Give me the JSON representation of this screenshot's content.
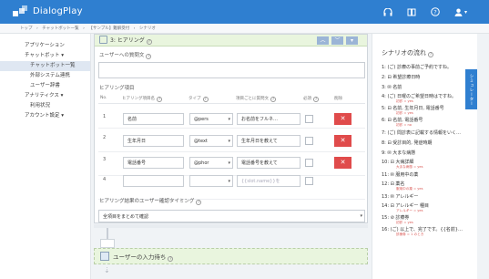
{
  "app": {
    "name": "DialogPlay"
  },
  "header": {
    "icons": [
      "headset-icon",
      "book-icon",
      "help-icon",
      "user-icon"
    ],
    "user_caret": "▾"
  },
  "breadcrumb": [
    "トップ",
    "›",
    "チャットボット一覧",
    "›",
    "【サンプル】難解受付",
    "›",
    "シナリオ"
  ],
  "sidebar": {
    "items": [
      {
        "label": "アプリケーション",
        "sub": false,
        "active": false
      },
      {
        "label": "チャットボット ▾",
        "sub": false,
        "active": false
      },
      {
        "label": "チャットボット一覧",
        "sub": true,
        "active": true
      },
      {
        "label": "外部システム連携",
        "sub": true,
        "active": false
      },
      {
        "label": "ユーザー辞書",
        "sub": true,
        "active": false
      },
      {
        "label": "アナリティクス ▾",
        "sub": false,
        "active": false
      },
      {
        "label": "利用状況",
        "sub": true,
        "active": false
      },
      {
        "label": "アカウント設定 ▾",
        "sub": false,
        "active": false
      }
    ]
  },
  "hearing": {
    "title_num": "3",
    "title": "3: ヒアリング",
    "q_label": "ユーザーへの質問文",
    "q_value": "",
    "items_label": "ヒアリング項目",
    "headers": [
      "No.",
      "ヒアリング項目名",
      "タイプ",
      "項目ごとに質問文",
      "必須",
      "削除"
    ],
    "rows": [
      {
        "no": "1",
        "name": "名前",
        "type": "@pers",
        "question": "お名前をフルネ…",
        "placeholder": false
      },
      {
        "no": "2",
        "name": "生年月日",
        "type": "@text",
        "question": "生年月日を教えて",
        "placeholder": false
      },
      {
        "no": "3",
        "name": "電話番号",
        "type": "@phor",
        "question": "電話番号を教えて",
        "placeholder": false
      },
      {
        "no": "4",
        "name": "",
        "type": "",
        "question": "{{slot.name}}を",
        "placeholder": true
      }
    ],
    "confirm_label": "ヒアリング結果のユーザー確認タイミング",
    "confirm_value": "全項目をまとめて確認",
    "delete_symbol": "✕"
  },
  "wait": {
    "title": "ユーザーの入力待ち",
    "help": "?"
  },
  "scenario": {
    "title": "シナリオの流れ",
    "tab": "シミュレーター",
    "items": [
      {
        "text": "1: (ご) 診療の事前ご予約ですね。",
        "sub": ""
      },
      {
        "text": "2: ⊟ 希望診療日時",
        "sub": ""
      },
      {
        "text": "3: ✉ 名前",
        "sub": ""
      },
      {
        "text": "4: (ご) 日曜のご希望日時はですね。",
        "sub": "初診 = yes"
      },
      {
        "text": "5: ⊟ 名前, 生年月日, 電話番号",
        "sub": "初診 = yes"
      },
      {
        "text": "6: ⊟ 名前, 電話番号",
        "sub": "初診 = no"
      },
      {
        "text": "7: (ご) 問診表に記載する情報をいく…",
        "sub": ""
      },
      {
        "text": "8: ⊟ 受診目的, 発症時期",
        "sub": ""
      },
      {
        "text": "9: ✉ 大まな病態",
        "sub": ""
      },
      {
        "text": "10: ⊟ 大病詳細",
        "sub": "大まな病態 = yes"
      },
      {
        "text": "11: ✉ 服用中の薬",
        "sub": ""
      },
      {
        "text": "12: ⊟ 薬名",
        "sub": "服用中の薬 = yes"
      },
      {
        "text": "13: ✉ アレルギー",
        "sub": ""
      },
      {
        "text": "14: ⊟ アレルギー 種目",
        "sub": "アレルギー = yes"
      },
      {
        "text": "15: ⊘ 診療券",
        "sub": "初診 = yes"
      },
      {
        "text": "16: (ご) 以上で、完了です。{{名前}…",
        "sub": "診療券 = 1 のとき"
      }
    ]
  }
}
